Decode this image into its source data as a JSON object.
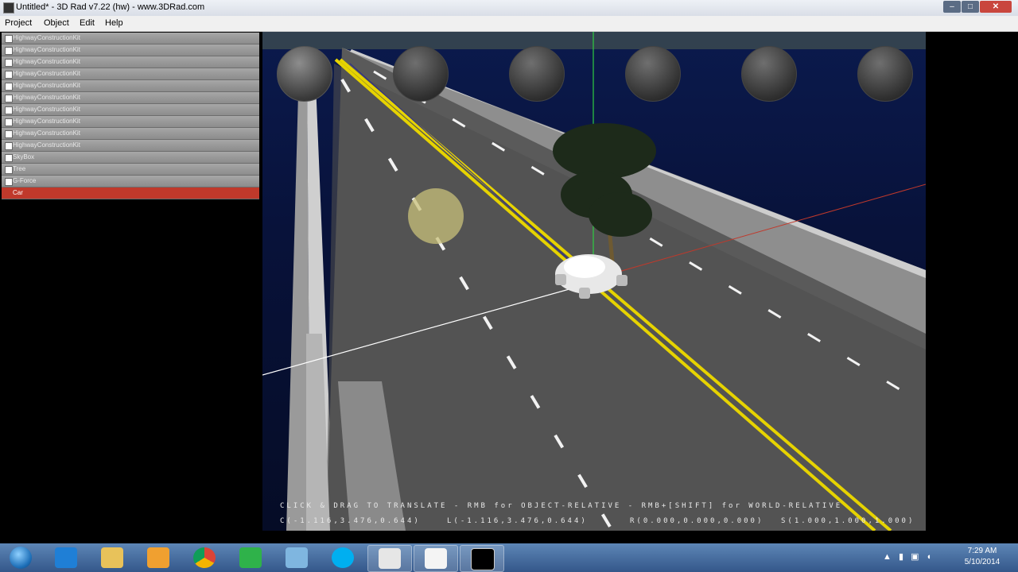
{
  "window": {
    "title": "Untitled* - 3D Rad v7.22 (hw) - www.3DRad.com",
    "buttons": {
      "minimize": "–",
      "maximize": "□",
      "close": "✕"
    }
  },
  "menu": {
    "items": [
      "Project",
      "Object",
      "Edit",
      "Help"
    ]
  },
  "objects": {
    "items": [
      "HighwayConstructionKit",
      "HighwayConstructionKit",
      "HighwayConstructionKit",
      "HighwayConstructionKit",
      "HighwayConstructionKit",
      "HighwayConstructionKit",
      "HighwayConstructionKit",
      "HighwayConstructionKit",
      "HighwayConstructionKit",
      "HighwayConstructionKit",
      "SkyBox",
      "Tree",
      "G-Force",
      "Car"
    ],
    "selected": "Car"
  },
  "viewport": {
    "hint": "CLICK & DRAG TO TRANSLATE - RMB for OBJECT-RELATIVE - RMB+[SHIFT] for WORLD-RELATIVE",
    "coords": {
      "c": "C(-1.116,3.476,0.644)",
      "l": "L(-1.116,3.476,0.644)",
      "r": "R(0.000,0.000,0.000)",
      "s": "S(1.000,1.000,1.000)"
    },
    "gizmo_icons": [
      "translate-icon",
      "move-vertical-icon",
      "rotate-icon",
      "orbit-icon",
      "rotate-axis-icon",
      "zoom-icon"
    ]
  },
  "taskbar": {
    "apps": [
      "internet-explorer-icon",
      "file-explorer-icon",
      "media-player-icon",
      "chrome-icon",
      "green-app-icon",
      "recycle-app-icon",
      "skype-icon",
      "window-icon",
      "document-icon",
      "black-app-icon"
    ],
    "clock_time": "7:29 AM",
    "clock_date": "5/10/2014"
  },
  "colors": {
    "sky": "#0a1748",
    "road": "#555555",
    "selected_row": "#c0392b",
    "taskbar": "#3b5f92"
  }
}
